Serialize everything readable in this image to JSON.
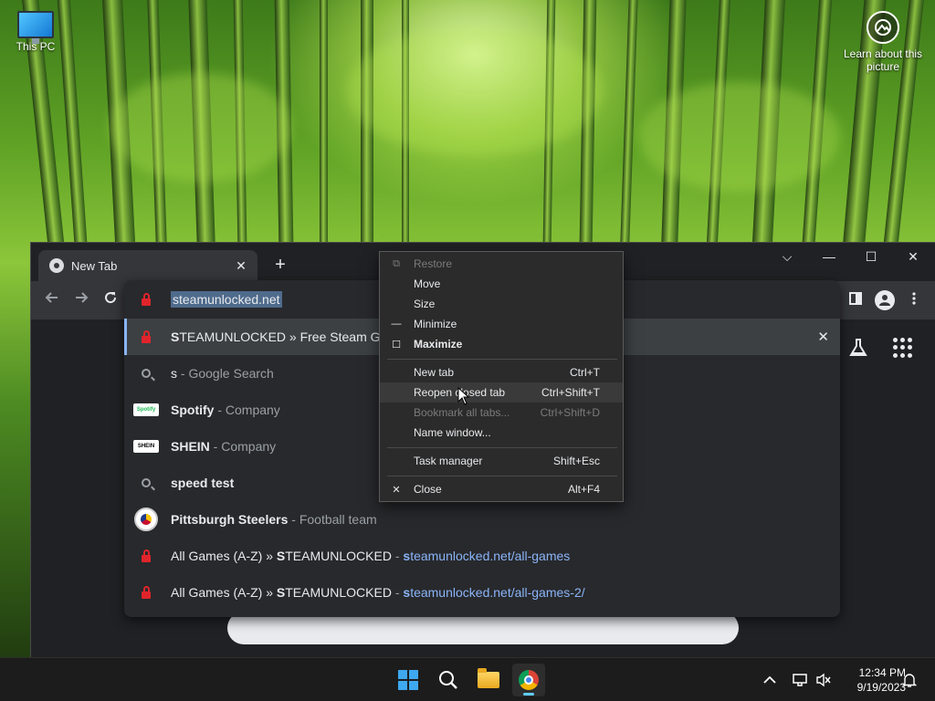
{
  "desktop": {
    "icons": [
      {
        "label": "This PC"
      },
      {
        "label": "Learn about this picture"
      }
    ]
  },
  "browser": {
    "tab_title": "New Tab",
    "tab_close": "✕",
    "new_tab_symbol": "+",
    "window_controls": {
      "tab_search": "⌵",
      "minimize": "—",
      "maximize": "☐",
      "close": "✕"
    }
  },
  "omnibox": {
    "input_value": "steamunlocked.net",
    "suggestions": [
      {
        "bold": "S",
        "text": "TEAMUNLOCKED » Free Steam Gam",
        "desc": "",
        "url": "",
        "icon": "lock-icon",
        "selected": true,
        "remove": "✕"
      },
      {
        "bold": "s",
        "text": "",
        "desc": " - Google Search",
        "url": "",
        "icon": "search-icon"
      },
      {
        "bold": "S",
        "text": "potify",
        "desc": " - Company",
        "url": "",
        "icon": "spotify-logo",
        "logo_text": "Spotify"
      },
      {
        "bold": "S",
        "text": "HEIN",
        "desc": " - Company",
        "url": "",
        "icon": "shein-logo",
        "logo_text": "SHEIN"
      },
      {
        "bold": "speed test",
        "text": "",
        "desc": "",
        "url": "",
        "icon": "search-icon"
      },
      {
        "bold": "Pittsburgh S",
        "text": "teelers",
        "desc": " - Football team",
        "url": "",
        "icon": "steelers-logo"
      },
      {
        "bold": "",
        "text": "All Games (A-Z) » ",
        "text_bold2": "S",
        "text2": "TEAMUNLOCKED",
        "desc": " - ",
        "url_bold": "s",
        "url": "teamunlocked.net/all-games",
        "icon": "lock-icon"
      },
      {
        "bold": "",
        "text": "All Games (A-Z) » ",
        "text_bold2": "S",
        "text2": "TEAMUNLOCKED",
        "desc": " - ",
        "url_bold": "s",
        "url": "teamunlocked.net/all-games-2/",
        "icon": "lock-icon"
      }
    ]
  },
  "context_menu": {
    "items": [
      {
        "label": "Restore",
        "shortcut": "",
        "glyph": "⧉",
        "disabled": true
      },
      {
        "label": "Move",
        "shortcut": "",
        "glyph": ""
      },
      {
        "label": "Size",
        "shortcut": "",
        "glyph": ""
      },
      {
        "label": "Minimize",
        "shortcut": "",
        "glyph": "—"
      },
      {
        "label": "Maximize",
        "shortcut": "",
        "glyph": "☐",
        "bold": true
      },
      {
        "label": "New tab",
        "shortcut": "Ctrl+T",
        "glyph": ""
      },
      {
        "label": "Reopen closed tab",
        "shortcut": "Ctrl+Shift+T",
        "glyph": "",
        "hover": true
      },
      {
        "label": "Bookmark all tabs...",
        "shortcut": "Ctrl+Shift+D",
        "glyph": "",
        "disabled": true
      },
      {
        "label": "Name window...",
        "shortcut": "",
        "glyph": ""
      },
      {
        "label": "Task manager",
        "shortcut": "Shift+Esc",
        "glyph": ""
      },
      {
        "label": "Close",
        "shortcut": "Alt+F4",
        "glyph": "✕"
      }
    ]
  },
  "taskbar": {
    "time": "12:34 PM",
    "date": "9/19/2023",
    "apps": [
      "start-button",
      "search",
      "file-explorer",
      "chrome"
    ]
  },
  "colors": {
    "accent": "#8ab4f8",
    "lock": "#e0242b",
    "taskbar_indicator": "#60cdff"
  }
}
